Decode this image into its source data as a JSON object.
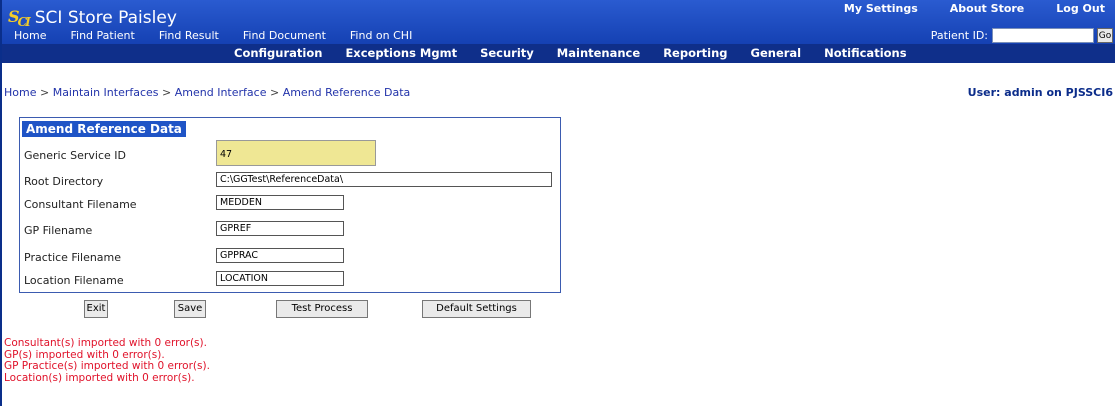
{
  "app": {
    "logo_text": "S",
    "logo_sub": "CI",
    "title": "SCI Store Paisley"
  },
  "top_links": [
    "My Settings",
    "About Store",
    "Log Out"
  ],
  "main_nav": [
    "Home",
    "Find Patient",
    "Find Result",
    "Find Document",
    "Find on CHI"
  ],
  "patient_id": {
    "label": "Patient ID:",
    "value": "",
    "go_label": "Go"
  },
  "sub_nav": [
    "Configuration",
    "Exceptions Mgmt",
    "Security",
    "Maintenance",
    "Reporting",
    "General",
    "Notifications"
  ],
  "breadcrumb": [
    "Home",
    "Maintain Interfaces",
    "Amend Interface",
    "Amend Reference Data"
  ],
  "user_text": "User: admin on PJSSCI6",
  "form": {
    "title": "Amend Reference Data",
    "fields": [
      {
        "label": "Generic Service ID",
        "value": "47"
      },
      {
        "label": "Root Directory",
        "value": "C:\\GGTest\\ReferenceData\\"
      },
      {
        "label": "Consultant Filename",
        "value": "MEDDEN"
      },
      {
        "label": "GP Filename",
        "value": "GPREF"
      },
      {
        "label": "Practice Filename",
        "value": "GPPRAC"
      },
      {
        "label": "Location Filename",
        "value": "LOCATION"
      }
    ]
  },
  "buttons": {
    "exit": "Exit",
    "save": "Save",
    "test": "Test Process",
    "defaults": "Default Settings"
  },
  "messages": [
    "Consultant(s) imported with 0 error(s).",
    "GP(s) imported with 0 error(s).",
    "GP Practice(s) imported with 0 error(s).",
    "Location(s) imported with 0 error(s)."
  ],
  "colors": {
    "header": "#1e4fc2",
    "subnav": "#0f2f8a",
    "error": "#e0122a",
    "readonly_field": "#efe794"
  }
}
